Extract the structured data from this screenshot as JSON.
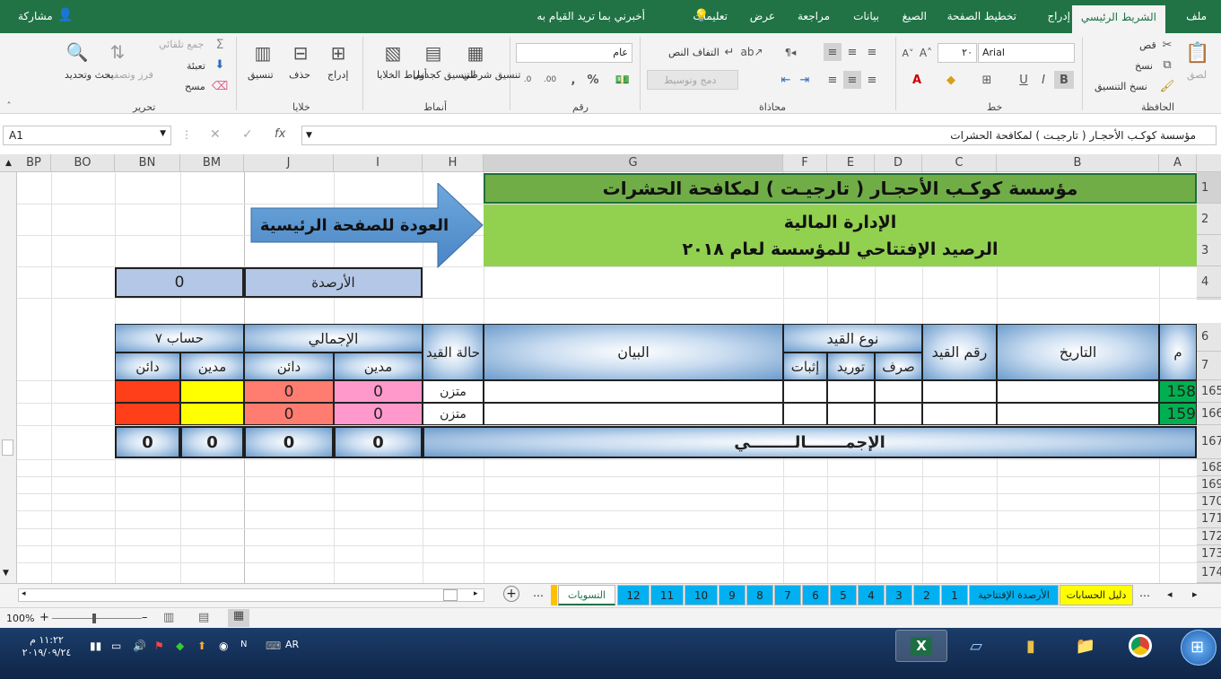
{
  "menu": {
    "file": "ملف",
    "home": "الشريط الرئيسي",
    "insert": "إدراج",
    "page_layout": "تخطيط الصفحة",
    "formulas": "الصيغ",
    "data": "بيانات",
    "review": "مراجعة",
    "view": "عرض",
    "help": "تعليمات",
    "tell_me": "أخبرني بما تريد القيام به",
    "share": "مشاركة"
  },
  "ribbon": {
    "paste": "لصق",
    "cut": "قص",
    "copy": "نسخ",
    "format_painter": "نسخ التنسيق",
    "clipboard": "الحافظة",
    "font_name": "Arial",
    "font_size": "٢٠",
    "font": "خط",
    "wrap_text": "التفاف النص",
    "merge_center": "دمج وتوسيط",
    "alignment": "محاذاة",
    "number_format": "عام",
    "number": "رقم",
    "conditional_format": "تنسيق شرطي",
    "format_as_table": "التنسيق كجدول",
    "cell_styles": "أنماط الخلايا",
    "styles": "أنماط",
    "insert_cells": "إدراج",
    "delete_cells": "حذف",
    "format_cells": "تنسيق",
    "cells": "خلايا",
    "autosum": "جمع تلقائي",
    "fill": "تعبئة",
    "clear": "مسح",
    "sort_filter": "فرز وتصفية",
    "find_select": "بحث وتحديد",
    "editing": "تحرير"
  },
  "formula_bar": {
    "name_box": "A1",
    "fx": "fx",
    "content": "مؤسسة كوكـب الأحجـار ( تارجيـت ) لمكافحة الحشرات"
  },
  "columns": [
    "A",
    "B",
    "C",
    "D",
    "E",
    "F",
    "G",
    "H",
    "I",
    "J",
    "BM",
    "BN",
    "BO",
    "BP"
  ],
  "rows": [
    "1",
    "2",
    "3",
    "4",
    "6",
    "7",
    "165",
    "166",
    "167",
    "168",
    "169",
    "170",
    "171",
    "172",
    "173",
    "174"
  ],
  "sheet": {
    "title": "مؤسسة كوكـب الأحجـار ( تارجيـت ) لمكافحة الحشرات",
    "dept": "الإدارة المالية",
    "subtitle": "الرصيد الإفتتاحي للمؤسسة لعام ٢٠١٨",
    "back_button": "العودة للصفحة الرئيسية",
    "balances_label": "الأرصدة",
    "balances_value": "0",
    "headers": {
      "m": "م",
      "date": "التاريخ",
      "entry_no": "رقم القيد",
      "entry_type": "نوع القيد",
      "spend": "صرف",
      "supply": "توريد",
      "proof": "إثبات",
      "statement": "البيان",
      "entry_status": "حالة القيد",
      "total": "الإجمالي",
      "debit": "مدين",
      "credit": "دائن",
      "account7": "حساب ٧",
      "debit2": "مدين",
      "credit2": "دائن"
    },
    "data_rows": [
      {
        "m": "158",
        "status": "متزن",
        "debit": "0",
        "credit": "0"
      },
      {
        "m": "159",
        "status": "متزن",
        "debit": "0",
        "credit": "0"
      }
    ],
    "totals": {
      "label": "الإجمـــــــالــــــــي",
      "debit": "0",
      "credit": "0",
      "bm": "0",
      "bn": "0"
    }
  },
  "sheet_tabs": [
    "دليل الحسابات",
    "الأرصدة الإفتتاحية",
    "1",
    "2",
    "3",
    "4",
    "5",
    "6",
    "7",
    "8",
    "9",
    "10",
    "11",
    "12",
    "التسويات"
  ],
  "status": {
    "zoom": "100%"
  },
  "taskbar": {
    "lang": "AR",
    "time": "١١:٢٢ م",
    "date": "٢٠١٩/٠٩/٢٤"
  },
  "colors": {
    "excel_green": "#217346",
    "title_green": "#70ad47",
    "header_green": "#92d050",
    "red": "#ff3f1a",
    "yellow": "#ffff00",
    "pink": "#ff99cc",
    "salmon": "#ff7c70",
    "tab_blue": "#00b0f0",
    "tab_yellow": "#ffff00"
  }
}
